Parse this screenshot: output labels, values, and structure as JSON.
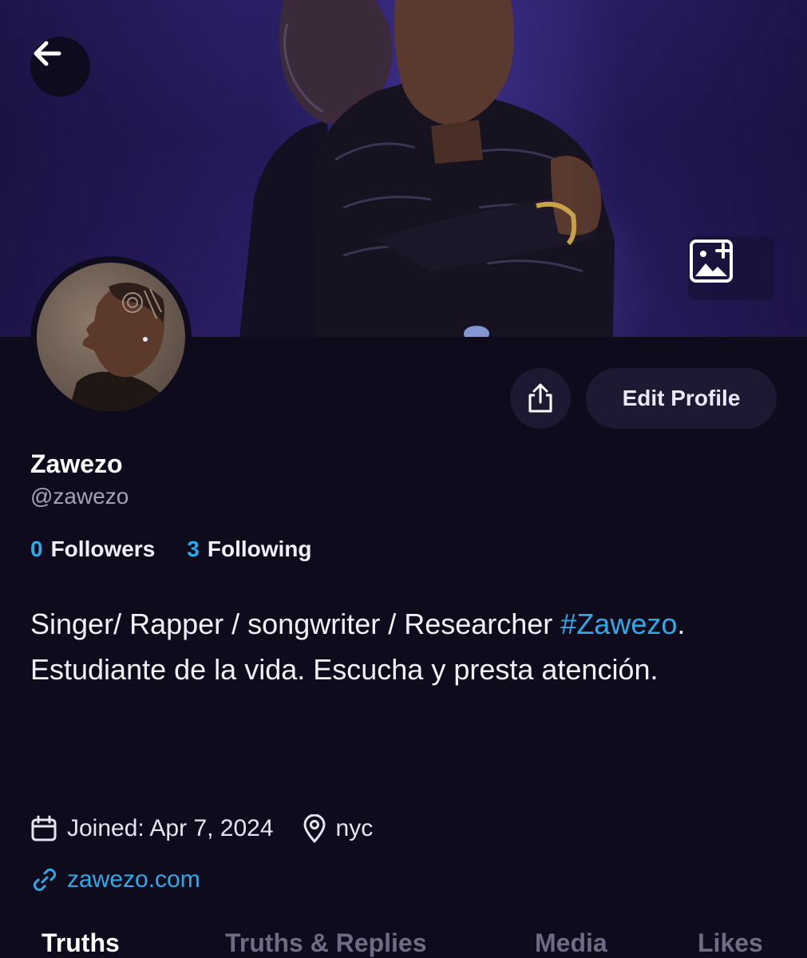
{
  "header": {
    "back_icon": "arrow-left-icon",
    "add_cover_icon": "image-plus-icon"
  },
  "profile": {
    "display_name": "Zawezo",
    "handle": "@zawezo",
    "followers_count": "0",
    "followers_label": "Followers",
    "following_count": "3",
    "following_label": "Following",
    "bio_before": "Singer/ Rapper / songwriter / Researcher ",
    "bio_hashtag": "#Zawezo",
    "bio_after": ". Estudiante de la vida. Escucha y presta atención.",
    "joined": "Joined: Apr 7, 2024",
    "location": "nyc",
    "website": "zawezo.com"
  },
  "actions": {
    "share_icon": "share-icon",
    "edit_profile_label": "Edit Profile"
  },
  "tabs": [
    {
      "label": "Truths",
      "active": true
    },
    {
      "label": "Truths & Replies",
      "active": false
    },
    {
      "label": "Media",
      "active": false
    },
    {
      "label": "Likes",
      "active": false
    }
  ],
  "colors": {
    "background": "#0e0b1c",
    "accent": "#2fa9e8",
    "button_bg": "#1c1933",
    "muted_text": "#a4a2b3",
    "inactive_tab": "#6e6b82"
  }
}
